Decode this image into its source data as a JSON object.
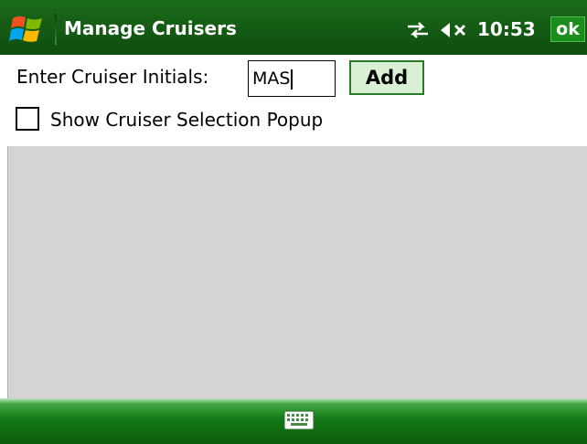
{
  "titlebar": {
    "title": "Manage Cruisers",
    "time": "10:53",
    "ok_label": "ok",
    "icons": {
      "start": "windows-flag-icon",
      "connectivity": "connectivity-icon",
      "volume": "volume-muted-icon"
    }
  },
  "form": {
    "initials_label": "Enter Cruiser Initials:",
    "initials_value": "MAS",
    "add_label": "Add",
    "popup_checkbox_label": "Show Cruiser Selection Popup",
    "popup_checkbox_checked": false
  },
  "bottombar": {
    "icon": "keyboard-icon"
  },
  "colors": {
    "titlebar_bg": "#0e4d0e",
    "add_button_bg": "#d9f0d4",
    "panel_bg": "#d6d3d6"
  }
}
